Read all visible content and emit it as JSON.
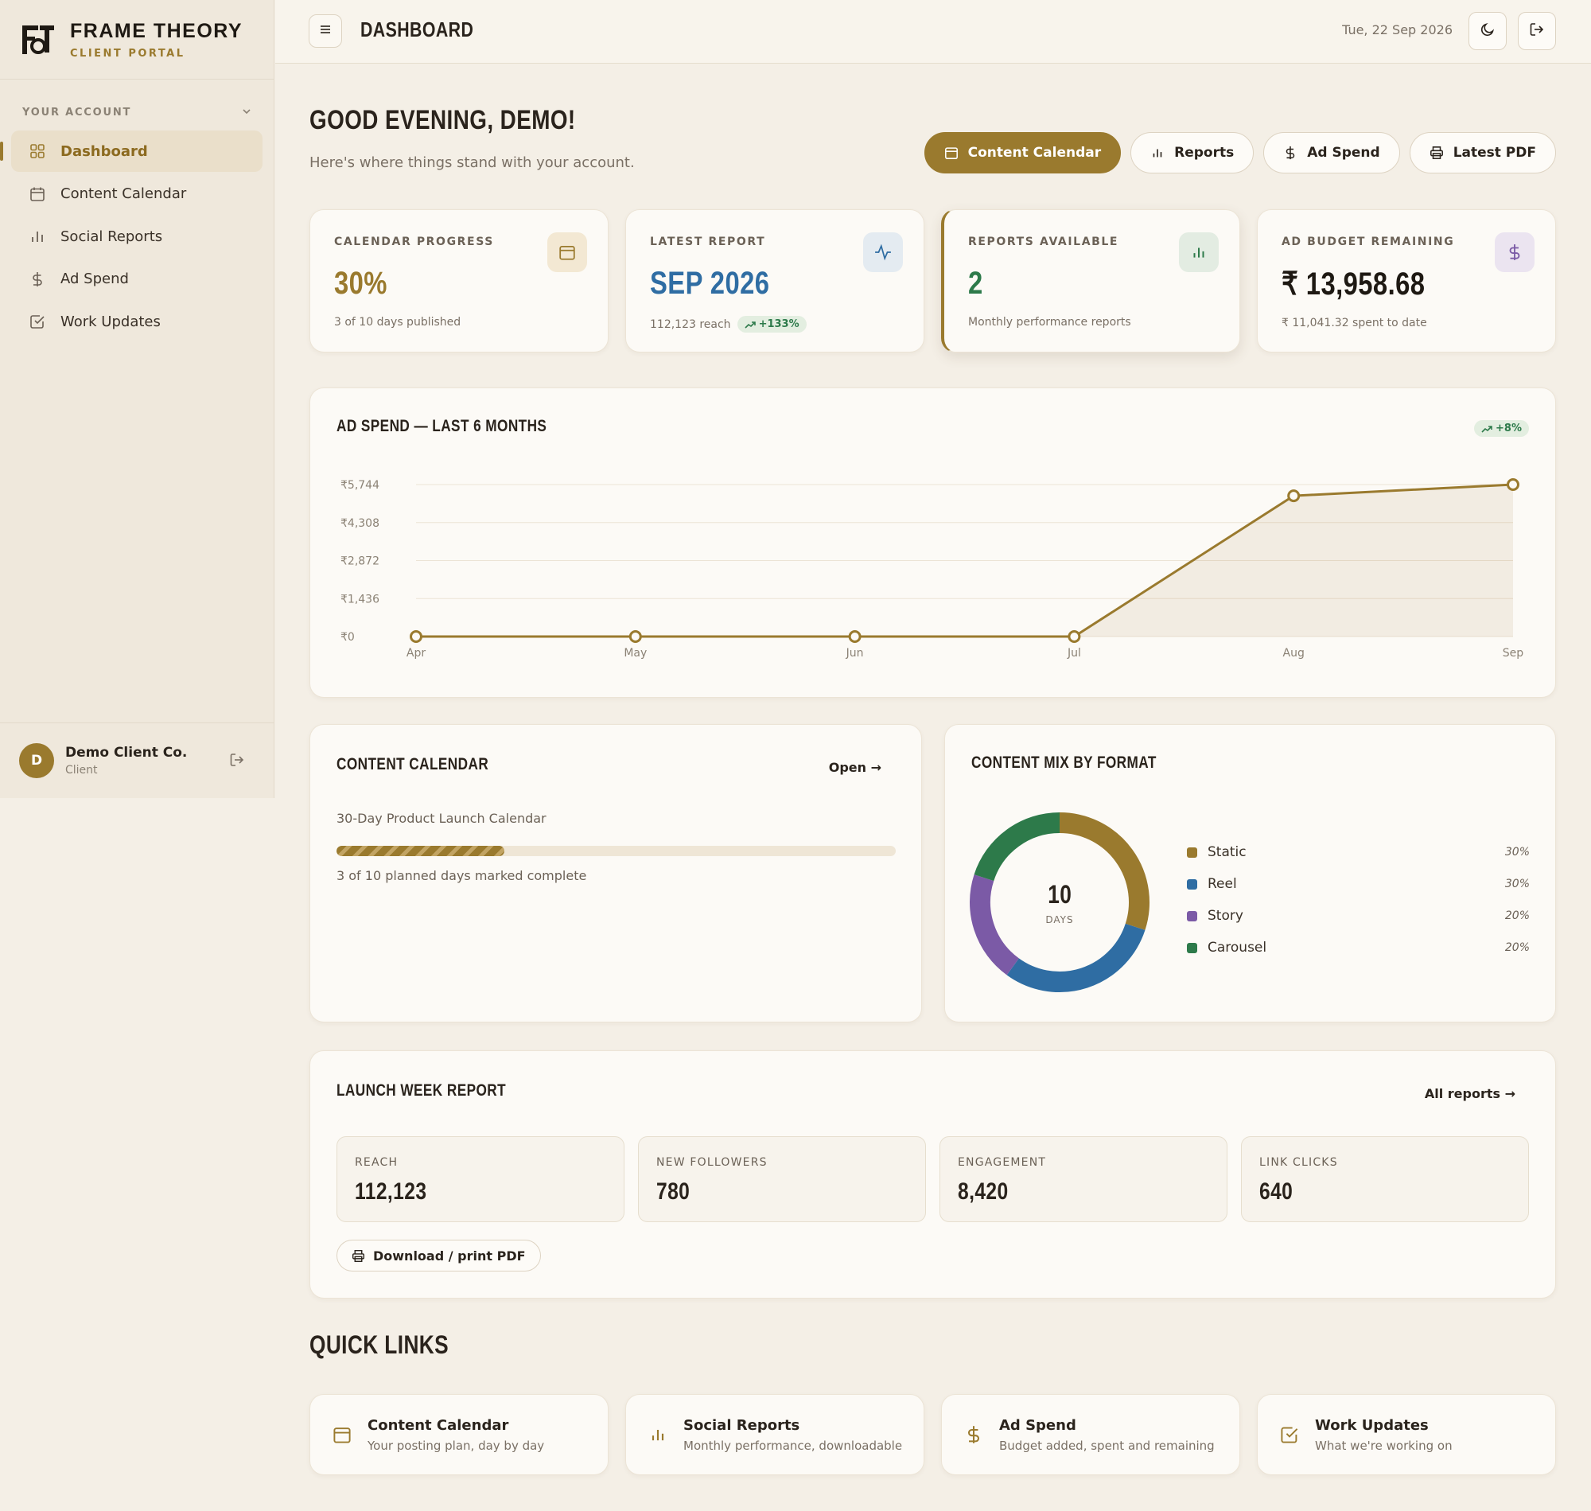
{
  "brand": {
    "name": "FRAME THEORY",
    "sub": "CLIENT PORTAL"
  },
  "sidebar": {
    "section_label": "YOUR ACCOUNT",
    "items": [
      {
        "label": "Dashboard",
        "icon": "grid-icon"
      },
      {
        "label": "Content Calendar",
        "icon": "calendar-icon"
      },
      {
        "label": "Social Reports",
        "icon": "bar-chart-icon"
      },
      {
        "label": "Ad Spend",
        "icon": "dollar-icon"
      },
      {
        "label": "Work Updates",
        "icon": "checkbox-icon"
      }
    ],
    "user": {
      "initial": "D",
      "name": "Demo Client Co.",
      "role": "Client"
    }
  },
  "topbar": {
    "title": "DASHBOARD",
    "date": "Tue, 22 Sep 2026"
  },
  "greeting": {
    "title": "GOOD EVENING, DEMO!",
    "subtitle": "Here's where things stand with your account."
  },
  "actions": [
    "Content Calendar",
    "Reports",
    "Ad Spend",
    "Latest PDF"
  ],
  "stats": [
    {
      "label": "CALENDAR PROGRESS",
      "value": "30%",
      "sub": "3 of 10 days published",
      "color": "#9a7a2e"
    },
    {
      "label": "LATEST REPORT",
      "value": "SEP 2026",
      "sub": "112,123 reach",
      "badge": "+133%",
      "color": "#2f6da3"
    },
    {
      "label": "REPORTS AVAILABLE",
      "value": "2",
      "sub": "Monthly performance reports",
      "color": "#2d7a4a"
    },
    {
      "label": "AD BUDGET REMAINING",
      "value": "₹ 13,958.68",
      "sub": "₹ 11,041.32 spent to date",
      "color": "#1e1913"
    }
  ],
  "chart_data": {
    "type": "area",
    "title": "AD SPEND — LAST 6 MONTHS",
    "badge": "+8%",
    "categories": [
      "Apr",
      "May",
      "Jun",
      "Jul",
      "Aug",
      "Sep"
    ],
    "values": [
      0,
      0,
      0,
      0,
      5320,
      5744
    ],
    "y_ticks": [
      "₹5,744",
      "₹4,308",
      "₹2,872",
      "₹1,436",
      "₹0"
    ],
    "ylim": [
      0,
      5744
    ],
    "grid": true,
    "color": "#9a7a2e"
  },
  "calendar_card": {
    "title": "CONTENT CALENDAR",
    "open_label": "Open →",
    "plan_name": "30-Day Product Launch Calendar",
    "progress": 0.3,
    "progress_text": "3 of 10 planned days marked complete"
  },
  "mix_card": {
    "title": "CONTENT MIX BY FORMAT",
    "center_value": "10",
    "center_label": "DAYS",
    "segments": [
      {
        "name": "Static",
        "pct": "30%",
        "value": 30,
        "color": "#9a7a2e"
      },
      {
        "name": "Reel",
        "pct": "30%",
        "value": 30,
        "color": "#2f6da3"
      },
      {
        "name": "Story",
        "pct": "20%",
        "value": 20,
        "color": "#7b5aa6"
      },
      {
        "name": "Carousel",
        "pct": "20%",
        "value": 20,
        "color": "#2d7a4a"
      }
    ]
  },
  "report_card": {
    "title": "LAUNCH WEEK REPORT",
    "all_label": "All reports →",
    "metrics": [
      {
        "label": "REACH",
        "value": "112,123"
      },
      {
        "label": "NEW FOLLOWERS",
        "value": "780"
      },
      {
        "label": "ENGAGEMENT",
        "value": "8,420"
      },
      {
        "label": "LINK CLICKS",
        "value": "640"
      }
    ],
    "download_label": "Download / print PDF"
  },
  "quick_links": {
    "title": "QUICK LINKS",
    "items": [
      {
        "name": "Content Calendar",
        "desc": "Your posting plan, day by day"
      },
      {
        "name": "Social Reports",
        "desc": "Monthly performance, downloadable"
      },
      {
        "name": "Ad Spend",
        "desc": "Budget added, spent and remaining"
      },
      {
        "name": "Work Updates",
        "desc": "What we're working on"
      }
    ]
  }
}
